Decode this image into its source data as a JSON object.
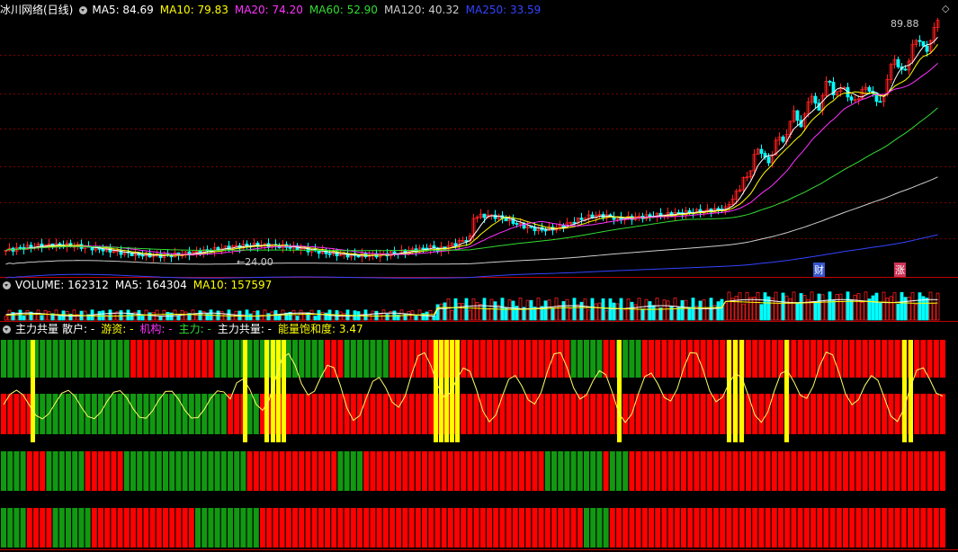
{
  "app": {
    "stock_name": "冰川网络(日线)"
  },
  "price_header": {
    "items": [
      {
        "label": "MA5: 84.69",
        "color": "#ffffff"
      },
      {
        "label": "MA10: 79.83",
        "color": "#ffff00"
      },
      {
        "label": "MA20: 74.20",
        "color": "#ff33ff"
      },
      {
        "label": "MA60: 52.90",
        "color": "#33dd33"
      },
      {
        "label": "MA120: 40.32",
        "color": "#cccccc"
      },
      {
        "label": "MA250: 33.59",
        "color": "#3344ff"
      }
    ]
  },
  "price_chart": {
    "high_label": "89.88",
    "low_label": "24.00",
    "badges": [
      {
        "text": "财",
        "color": "#3355cc"
      },
      {
        "text": "涨",
        "color": "#cc3355"
      }
    ]
  },
  "volume_header": {
    "items": [
      {
        "label": "VOLUME: 162312",
        "color": "#ffffff"
      },
      {
        "label": "MA5: 164304",
        "color": "#ffffff"
      },
      {
        "label": "MA10: 157597",
        "color": "#ffff00"
      }
    ]
  },
  "indicator_header": {
    "title": "主力共量",
    "items": [
      {
        "label": "散户: -",
        "color": "#ffffff"
      },
      {
        "label": "游资: -",
        "color": "#ffff00"
      },
      {
        "label": "机构: -",
        "color": "#ff33ff"
      },
      {
        "label": "主力: -",
        "color": "#33dd33"
      },
      {
        "label": "主力共量: -",
        "color": "#ffffff"
      },
      {
        "label": "能量饱和度: 3.47",
        "color": "#ffff00"
      }
    ]
  },
  "colors": {
    "up": "#ff2020",
    "down": "#00ffff",
    "grid": "#7a0000",
    "red_bar": "#ff0000",
    "green_bar": "#119911",
    "signal": "#ffff00"
  }
}
